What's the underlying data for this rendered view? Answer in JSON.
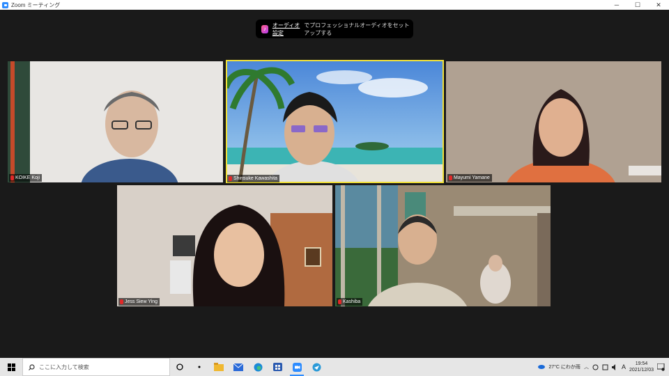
{
  "window": {
    "title": "Zoom ミーティング"
  },
  "window_controls": {
    "minimize": "─",
    "maximize": "☐",
    "close": "✕"
  },
  "banner": {
    "link_text": "オーディオ設定",
    "text": "でプロフェッショナルオーディオをセットアップする"
  },
  "participants": [
    {
      "name": "KOIKE Koji",
      "active": false
    },
    {
      "name": "Shinsuke Kawashita",
      "active": true
    },
    {
      "name": "Mayumi Yamane",
      "active": false
    },
    {
      "name": "Jess Siew Ying",
      "active": false
    },
    {
      "name": "Kashiba",
      "active": false
    }
  ],
  "taskbar": {
    "search_placeholder": "ここに入力して検索",
    "weather": "27°C にわか雨",
    "ime": "A",
    "time": "19:54",
    "date": "2021/12/03"
  }
}
